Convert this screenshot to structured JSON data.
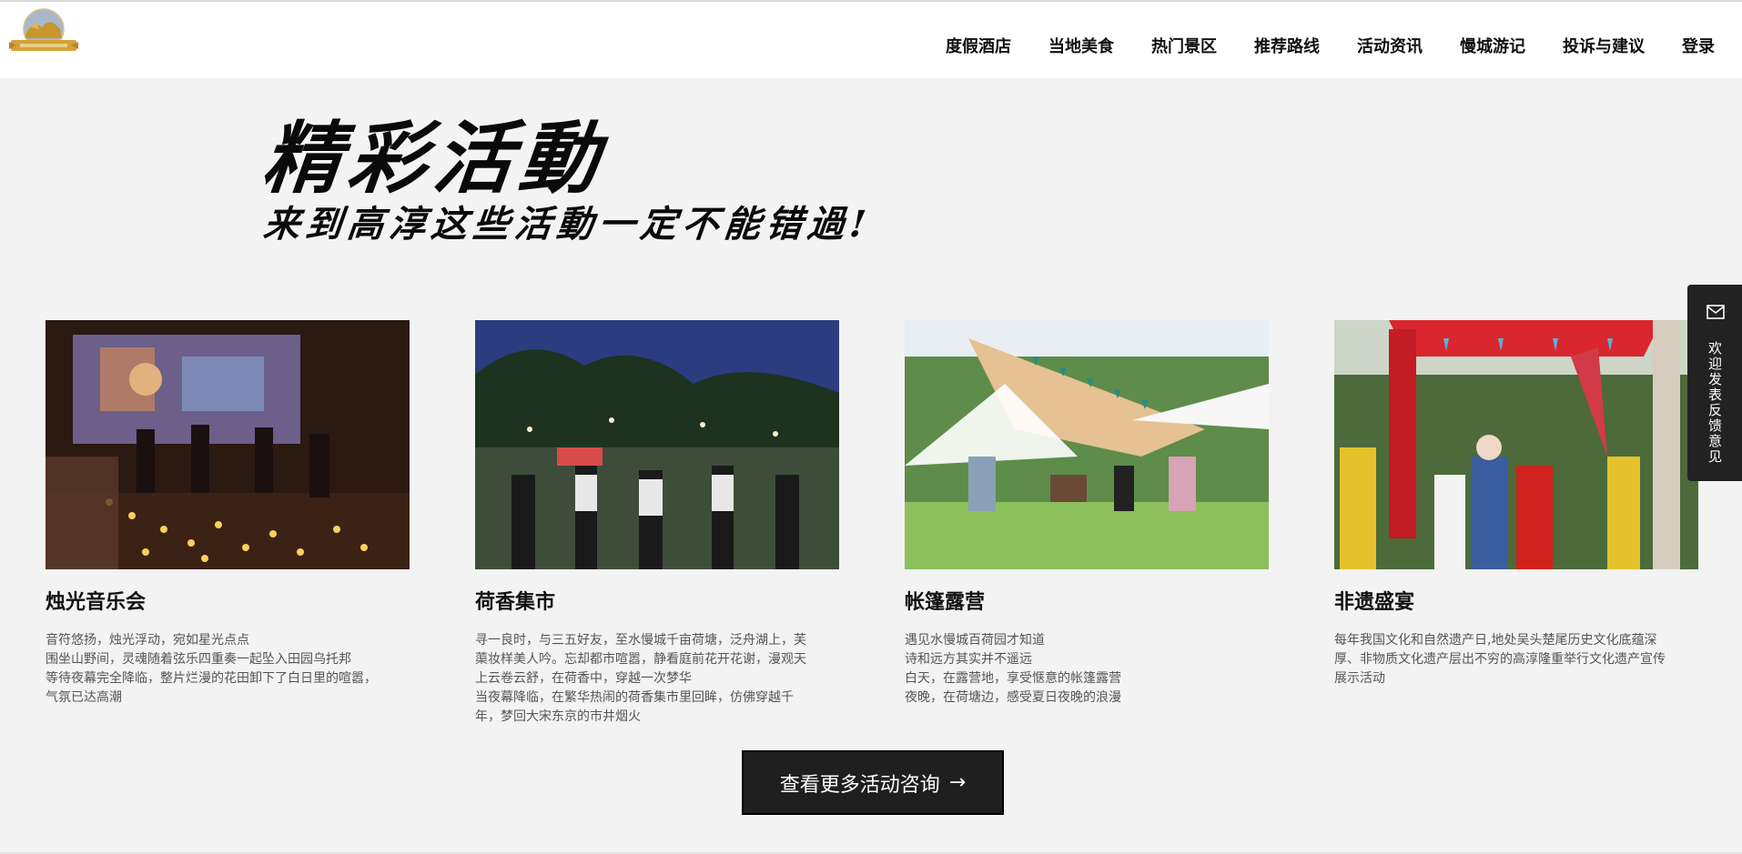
{
  "nav": {
    "items": [
      "度假酒店",
      "当地美食",
      "热门景区",
      "推荐路线",
      "活动资讯",
      "慢城游记",
      "投诉与建议",
      "登录"
    ]
  },
  "hero": {
    "title": "精彩活動",
    "subtitle": "来到高淳这些活動一定不能错過!"
  },
  "cards": [
    {
      "title": "烛光音乐会",
      "image_icon": "candlelight-concert-photo",
      "lines": [
        "音符悠扬，烛光浮动，宛如星光点点",
        "围坐山野间，灵魂随着弦乐四重奏一起坠入田园乌托邦",
        "等待夜幕完全降临，整片烂漫的花田卸下了白日里的喧嚣，",
        "气氛已达高潮"
      ]
    },
    {
      "title": "荷香集市",
      "image_icon": "night-market-photo",
      "lines": [
        "寻一良时，与三五好友，至水慢城千亩荷塘，泛舟湖上，芙",
        "蕖妆样美人吟。忘却都市喧嚣，静看庭前花开花谢，漫观天",
        "上云卷云舒，在荷香中，穿越一次梦华",
        "当夜幕降临，在繁华热闹的荷香集市里回眸，仿佛穿越千",
        "年，梦回大宋东京的市井烟火"
      ]
    },
    {
      "title": "帐篷露营",
      "image_icon": "tent-camping-photo",
      "lines": [
        "遇见水慢城百荷园才知道",
        "诗和远方其实并不遥远",
        "白天，在露营地，享受惬意的帐篷露营",
        "夜晚，在荷塘边，感受夏日夜晚的浪漫"
      ]
    },
    {
      "title": "非遗盛宴",
      "image_icon": "heritage-festival-photo",
      "lines": [
        "每年我国文化和自然遗产日,地处吴头楚尾历史文化底蕴深",
        "厚、非物质文化遗产层出不穷的高淳隆重举行文化遗产宣传",
        "展示活动"
      ]
    }
  ],
  "more_button": {
    "label": "查看更多活动咨询",
    "arrow": "→"
  },
  "feedback": {
    "label": "欢迎发表反馈意见",
    "icon": "mail-icon"
  },
  "colors": {
    "page_bg": "#f3f3f3",
    "header_bg": "#ffffff",
    "button_bg": "#1f1f1f",
    "logo_gold": "#c8962b"
  }
}
